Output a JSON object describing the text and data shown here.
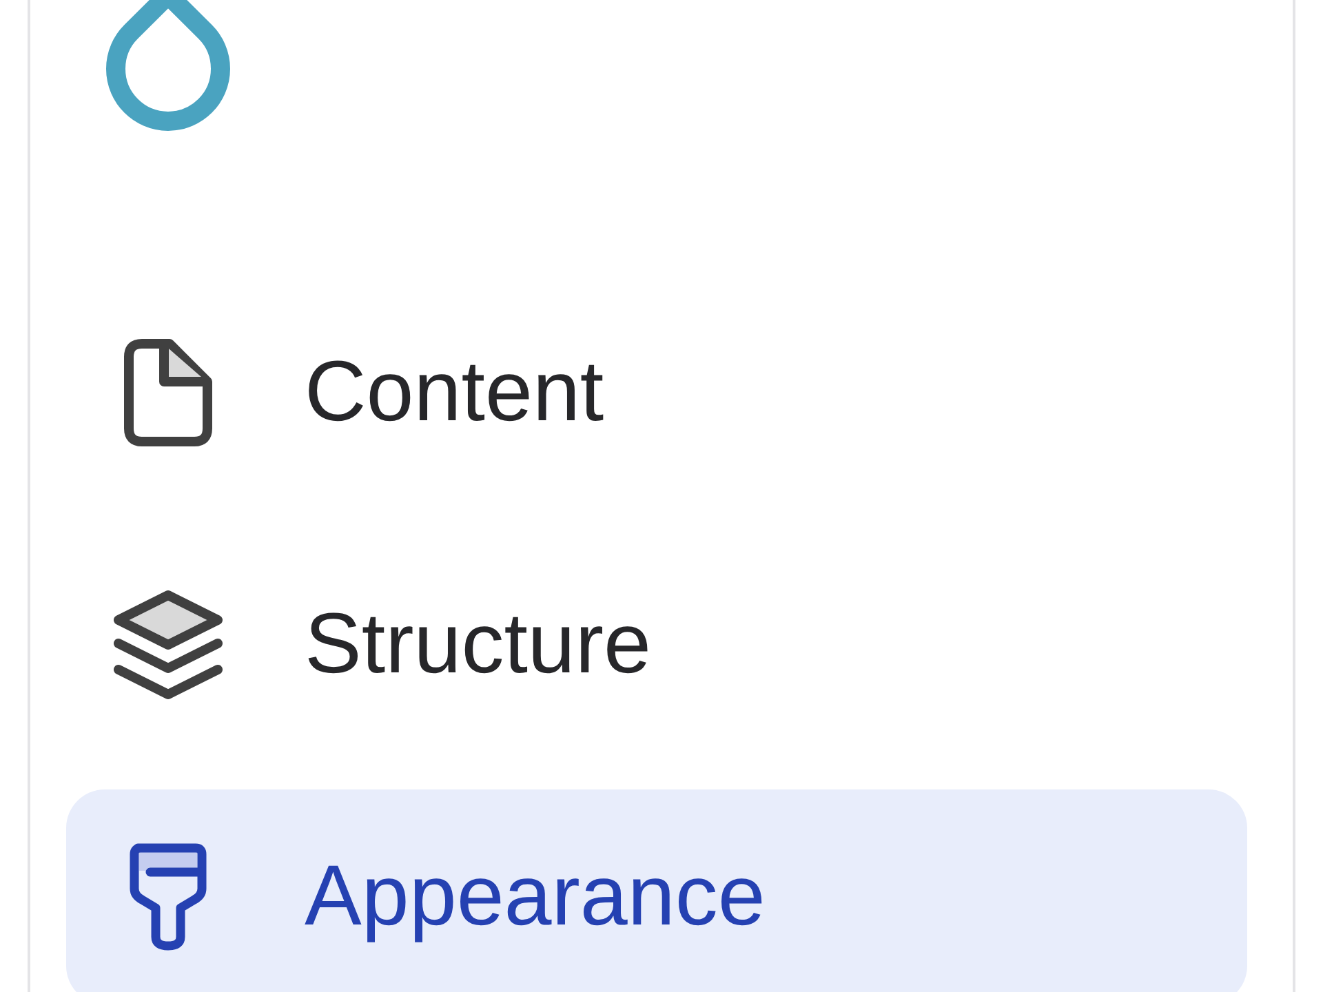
{
  "sidebar": {
    "nav_items": [
      {
        "label": "Content",
        "selected": false
      },
      {
        "label": "Structure",
        "selected": false
      },
      {
        "label": "Appearance",
        "selected": true
      }
    ]
  }
}
